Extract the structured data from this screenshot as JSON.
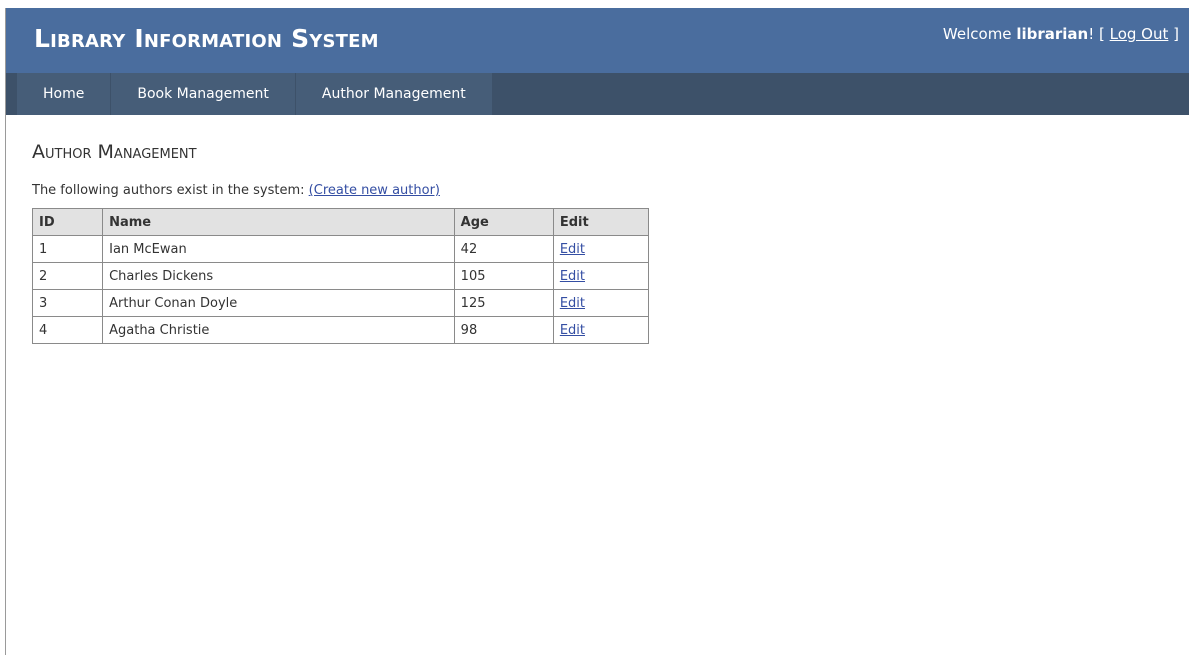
{
  "header": {
    "title": "Library Information System",
    "welcome_prefix": "Welcome ",
    "username": "librarian",
    "bracket_open": "! [ ",
    "logout_label": "Log Out",
    "bracket_close": " ]"
  },
  "nav": {
    "items": [
      {
        "label": "Home"
      },
      {
        "label": "Book Management"
      },
      {
        "label": "Author Management"
      }
    ]
  },
  "main": {
    "title": "Author Management",
    "intro_text": "The following authors exist in the system: ",
    "create_link": "(Create new author)",
    "table": {
      "columns": [
        "ID",
        "Name",
        "Age",
        "Edit"
      ],
      "rows": [
        {
          "id": "1",
          "name": "Ian McEwan",
          "age": "42",
          "edit": "Edit"
        },
        {
          "id": "2",
          "name": "Charles Dickens",
          "age": "105",
          "edit": "Edit"
        },
        {
          "id": "3",
          "name": "Arthur Conan Doyle",
          "age": "125",
          "edit": "Edit"
        },
        {
          "id": "4",
          "name": "Agatha Christie",
          "age": "98",
          "edit": "Edit"
        }
      ]
    }
  },
  "colors": {
    "header_bg": "#4a6d9e",
    "nav_bg": "#3d5169",
    "nav_item_bg": "#465d78",
    "link": "#344ea3"
  }
}
